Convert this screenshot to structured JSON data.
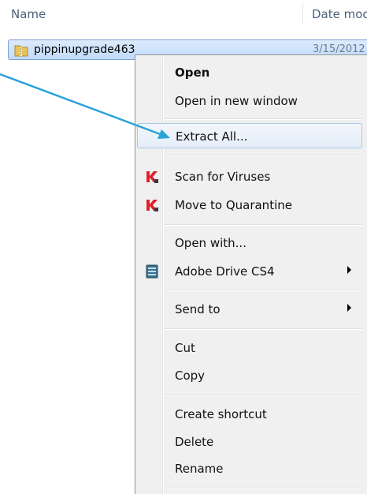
{
  "header": {
    "name_label": "Name",
    "date_label": "Date moc"
  },
  "file": {
    "name": "pippinupgrade463",
    "date": "3/15/2012"
  },
  "menu": {
    "open": "Open",
    "open_new_window": "Open in new window",
    "extract_all": "Extract All...",
    "scan_viruses": "Scan for Viruses",
    "move_quarantine": "Move to Quarantine",
    "open_with": "Open with...",
    "adobe_drive": "Adobe Drive CS4",
    "send_to": "Send to",
    "cut": "Cut",
    "copy": "Copy",
    "create_shortcut": "Create shortcut",
    "delete": "Delete",
    "rename": "Rename"
  },
  "icons": {
    "folder": "zip-folder-icon",
    "kaspersky": "kaspersky-icon",
    "adobe_drive": "adobe-drive-icon"
  },
  "colors": {
    "accent_arrow": "#2aa3d8",
    "selection": "#c1dbfc",
    "kaspersky_red": "#e0212b"
  }
}
